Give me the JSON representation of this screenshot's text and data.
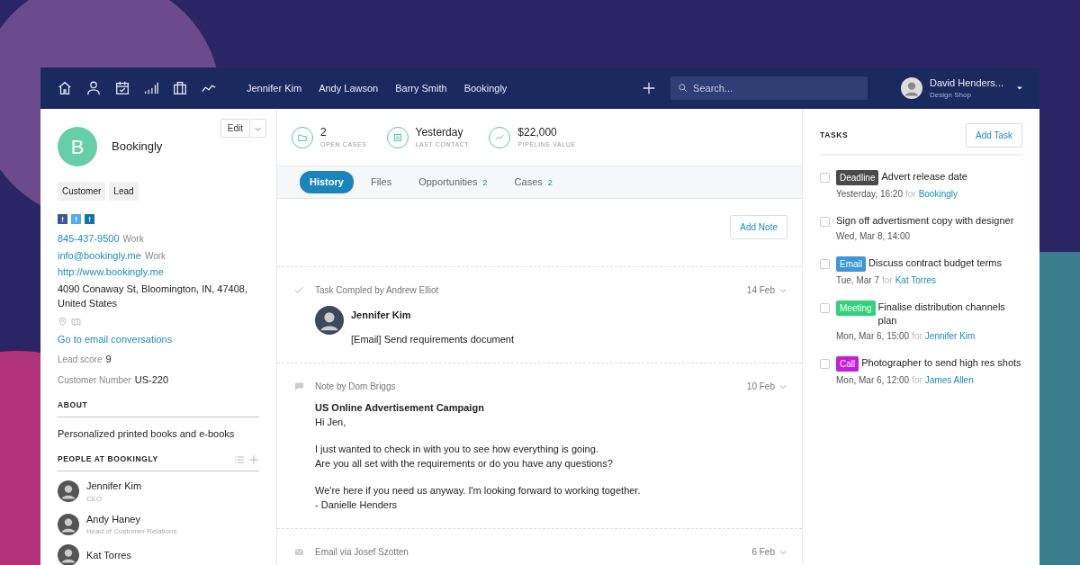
{
  "nav": {
    "links": [
      "Jennifer Kim",
      "Andy Lawson",
      "Barry Smith",
      "Bookingly"
    ],
    "search": {
      "placeholder": "Search..."
    },
    "user": {
      "name": "David Henders...",
      "company": "Design Shop"
    }
  },
  "company": {
    "initial": "B",
    "name": "Bookingly",
    "edit": "Edit",
    "tags": [
      "Customer",
      "Lead"
    ],
    "contacts": [
      {
        "kind": "link",
        "value": "845-437-9500",
        "label": "Work"
      },
      {
        "kind": "link",
        "value": "info@bookingly.me",
        "label": "Work"
      },
      {
        "kind": "link",
        "value": "http://www.bookingly.me"
      },
      {
        "kind": "text",
        "value": "4090 Conaway St, Bloomington, IN, 47408, United States"
      }
    ],
    "email_link": "Go to email conversations",
    "fields": [
      {
        "label": "Lead score",
        "value": "9"
      },
      {
        "label": "Customer Number",
        "value": "US-220"
      }
    ],
    "about_heading": "ABOUT",
    "about": "Personalized printed books and e-books",
    "people_heading": "PEOPLE AT BOOKINGLY",
    "people": [
      {
        "name": "Jennifer Kim",
        "role": "CEO"
      },
      {
        "name": "Andy Haney",
        "role": "Head of Customer Relations"
      },
      {
        "name": "Kat Torres"
      }
    ]
  },
  "stats": [
    {
      "kind": "folder",
      "value": "2",
      "label": "OPEN CASES"
    },
    {
      "kind": "calendar",
      "value": "Yesterday",
      "label": "LAST CONTACT"
    },
    {
      "kind": "trend",
      "value": "$22,000",
      "label": "PIPELINE VALUE"
    }
  ],
  "tabs": [
    {
      "label": "History",
      "selected": true
    },
    {
      "label": "Files",
      "selected": false
    },
    {
      "label": "Opportunities",
      "count": "2",
      "selected": false
    },
    {
      "label": "Cases",
      "count": "2",
      "selected": false
    }
  ],
  "add_note": "Add Note",
  "history": [
    {
      "kind": "task",
      "title": "Task Compled by Andrew Elliot",
      "date": "14 Feb",
      "person": "Jennifer Kim",
      "text": "[Email] Send requirements document"
    },
    {
      "kind": "note",
      "title": "Note by Dom Briggs",
      "date": "10 Feb",
      "heading": "US Online Advertisement Campaign",
      "paragraphs": [
        [
          "Hi Jen,"
        ],
        [
          "I just wanted to check in with you to see how everything is going.",
          "Are you all set with the requirements or do you have any questions?"
        ],
        [
          "We're here if you need us anyway. I'm looking forward to working together.",
          "- Danielle Henders"
        ]
      ]
    },
    {
      "kind": "email",
      "title": "Email via Josef Szotten",
      "date": "6 Feb"
    }
  ],
  "tasks": {
    "heading": "TASKS",
    "add": "Add Task",
    "items": [
      {
        "tag": "Deadline",
        "color": "#4a4a4a",
        "title": "Advert release date",
        "when": "Yesterday, 16:20",
        "for": "for",
        "who": "Bookingly",
        "checked": false
      },
      {
        "title": "Sign off advertisment copy with designer",
        "when": "Wed, Mar 8, 14:00",
        "checked": false
      },
      {
        "tag": "Email",
        "color": "#3d97d3",
        "title": "Discuss contract budget terms",
        "when": "Tue, Mar 7",
        "for": "for",
        "who": "Kat Torres",
        "checked": false
      },
      {
        "tag": "Meeting",
        "color": "#33d17a",
        "title": "Finalise distribution channels plan",
        "when": "Mon, Mar 6, 15:00",
        "for": "for",
        "who": "Jennifer Kim",
        "checked": false
      },
      {
        "tag": "Call",
        "color": "#c41fd6",
        "title": "Photographer to send high res shots",
        "when": "Mon, Mar 6, 12:00",
        "for": "for",
        "who": "James Allen",
        "checked": false
      }
    ]
  }
}
